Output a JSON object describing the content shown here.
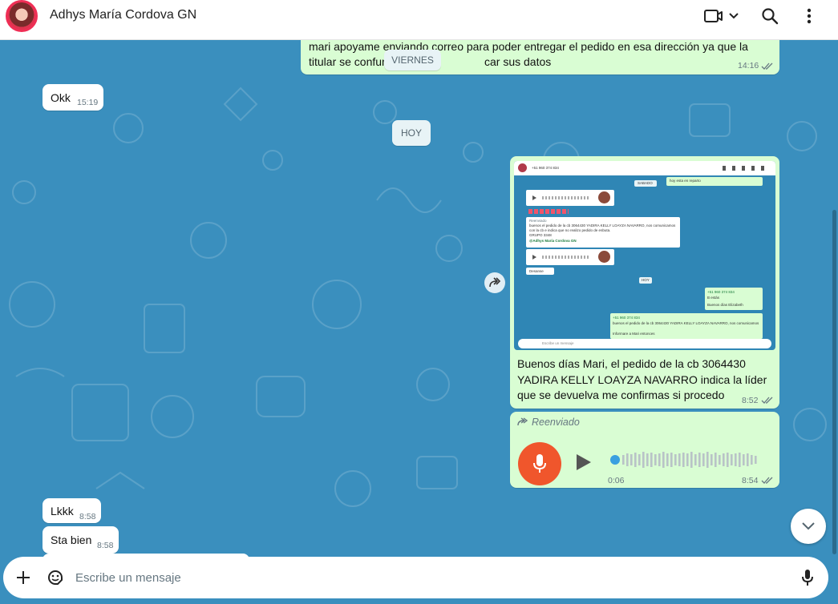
{
  "header": {
    "title": "Adhys María Cordova GN"
  },
  "dates": {
    "friday": "VIERNES",
    "today": "HOY"
  },
  "messages": {
    "m1": {
      "line1": "mari apoyame enviando correo para poder entregar el pedido en esa dirección ya que la",
      "line2a": "titular se confun",
      "line2b": "car sus datos",
      "time": "14:16"
    },
    "m2": {
      "text": "Okk",
      "time": "15:19"
    },
    "m3": {
      "line1": "Buenos días Mari, el pedido de la cb 3064430",
      "line2": "YADIRA KELLY LOAYZA NAVARRO indica la líder",
      "line3": "que se devuelva me confirmas si procedo",
      "time": "8:52"
    },
    "m4": {
      "forwarded": "Reenviado",
      "duration": "0:06",
      "time": "8:54"
    },
    "m5": {
      "text": "Lkkk",
      "time": "8:58"
    },
    "m6": {
      "text": "Sta bien",
      "time": "8:58"
    }
  },
  "thumbnail": {
    "phone": "+51 960 374 834",
    "sabado": "SABADO",
    "hoy": "HOY",
    "top_note": "hoy esta en reparto",
    "forwarded_label": "Reenviado",
    "fwd_line1": "buenos el pedido de la cb 3064430 YADIRA KELLY LOAYZA NAVARRO, nos comunicamos",
    "fwd_line2": "con la cb e indica que no realizo pedido de esbuta.",
    "fwd_line3": "GRUPO 3348",
    "fwd_sender": "@Adhys María Cordova GN",
    "desanse": "Desanse",
    "buenos_dias": "Buenos días Elizabeth",
    "b_ok": "B estás",
    "informare": "Informare a Mari entonces",
    "composer": "Escribe un mensaje"
  },
  "composer": {
    "placeholder": "Escribe un mensaje"
  },
  "colors": {
    "chat_bg": "#3a8fbe",
    "outgoing": "#d9fdd3",
    "incoming": "#ffffff",
    "mic": "#f0562c"
  }
}
